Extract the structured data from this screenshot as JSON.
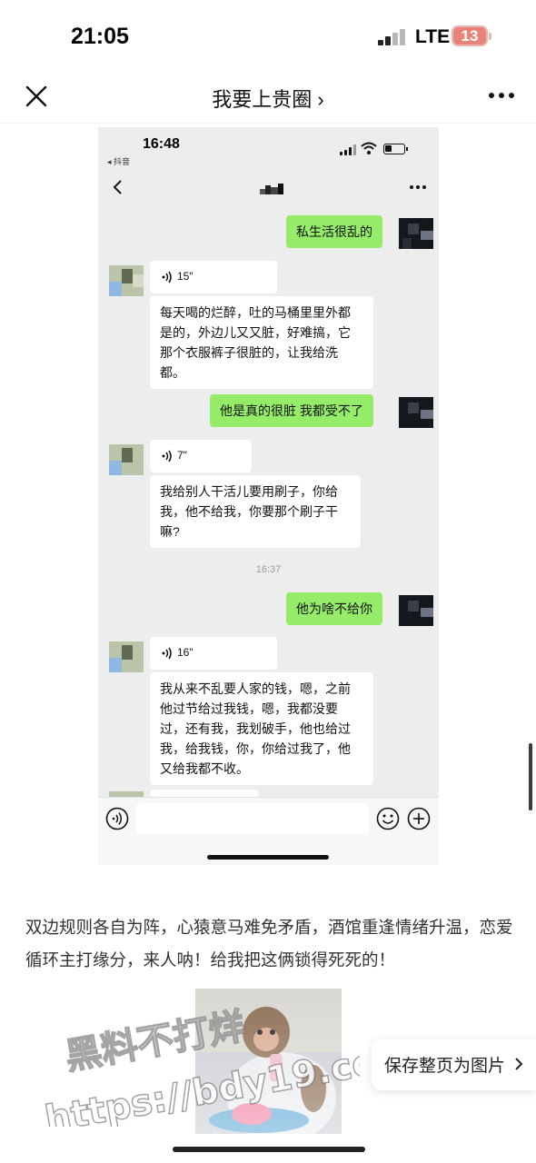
{
  "status_bar": {
    "time": "21:05",
    "network": "LTE",
    "battery": "13"
  },
  "header": {
    "title": "我要上贵圈 ›"
  },
  "embedded": {
    "status_time": "16:48",
    "back_app": "◂ 抖音",
    "messages": [
      {
        "side": "right",
        "text": "私生活很乱的"
      },
      {
        "side": "left",
        "voice": "15\"",
        "text": "每天喝的烂醉，吐的马桶里里外都\n是的，外边儿又又脏，好难搞，它\n那个衣服裤子很脏的，让我给洗\n都。"
      },
      {
        "side": "right",
        "text": "他是真的很脏 我都受不了"
      },
      {
        "side": "left",
        "voice": "7\"",
        "text": "我给别人干活儿要用刷子，你给\n我，他不给我，你要那个刷子干\n嘛?"
      },
      {
        "side": "right",
        "text": "他为啥不给你"
      },
      {
        "side": "left",
        "voice": "16\"",
        "text": "我从来不乱要人家的钱，嗯，之前\n他过节给过我钱，嗯，我都没要\n过，还有我，我划破手，他也给过\n我，给我钱，你，你给过我了，他\n又给我都不收。"
      }
    ],
    "timestamp": "16:37"
  },
  "article": {
    "text": "双边规则各自为阵，心猿意马难免矛盾，酒馆重逢情绪升温，恋爱循环主打缘分，来人呐！给我把这俩锁得死死的！"
  },
  "watermark": {
    "line1": "黑料不打烊",
    "line2": "https://bdy19.co"
  },
  "save_button": {
    "label": "保存整页为图片"
  },
  "icons": [
    "close-icon",
    "more-icon",
    "chevron-right-icon",
    "voice-wave-icon",
    "emoji-icon",
    "plus-icon",
    "wifi-icon",
    "battery-icon",
    "signal-icon"
  ]
}
